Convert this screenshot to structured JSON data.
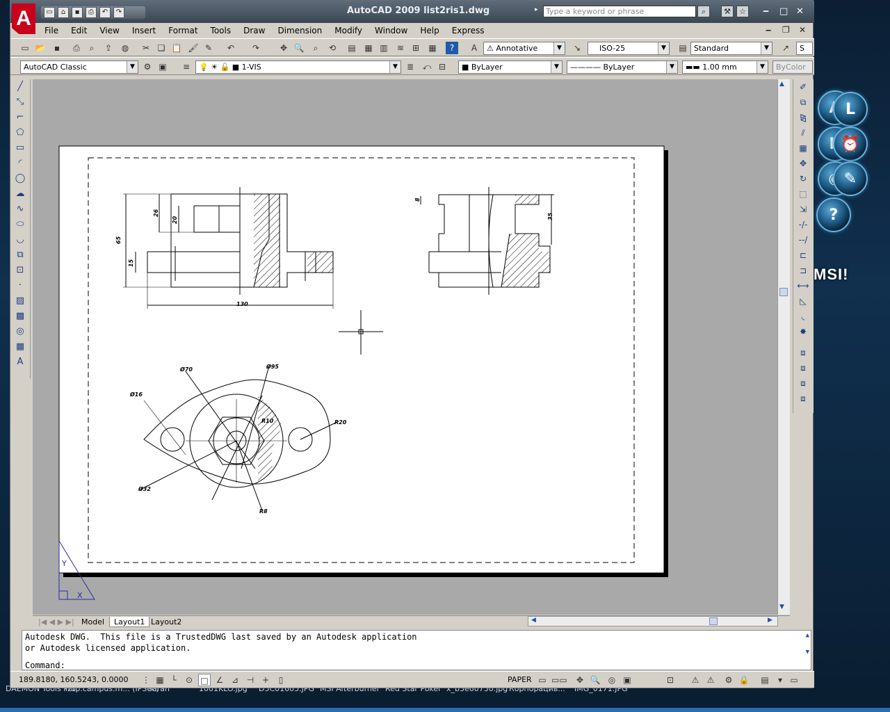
{
  "window": {
    "title": "AutoCAD 2009 list2ris1.dwg",
    "search_placeholder": "Type a keyword or phrase",
    "minimize": "‒",
    "maximize": "□",
    "close": "✕",
    "app_letter": "A"
  },
  "menubar": [
    "File",
    "Edit",
    "View",
    "Insert",
    "Format",
    "Tools",
    "Draw",
    "Dimension",
    "Modify",
    "Window",
    "Help",
    "Express"
  ],
  "styles_toolbar": {
    "text_style": "Annotative",
    "dim_style": "ISO-25",
    "table_style": "Standard",
    "multileader_style": "S"
  },
  "layers_toolbar": {
    "workspace": "AutoCAD Classic",
    "layer": "1-VIS",
    "color": "ByLayer",
    "linetype": "ByLayer",
    "lineweight": "1.00 mm",
    "plotstyle": "ByColor"
  },
  "drawing": {
    "dims_front": {
      "d26": "26",
      "d20": "20",
      "d65": "65",
      "d15": "15",
      "d130": "130"
    },
    "dims_side": {
      "d8": "8",
      "d35": "35"
    },
    "dims_top": {
      "d70": "Ø70",
      "d95": "Ø95",
      "d16": "Ø16",
      "r10": "R10",
      "r20": "R20",
      "d32": "Ø32",
      "r8": "R8"
    }
  },
  "ucs": {
    "x": "X",
    "y": "Y"
  },
  "layout_tabs": [
    "Model",
    "Layout1",
    "Layout2"
  ],
  "command": {
    "line1": "Autodesk DWG.  This file is a TrustedDWG last saved by an Autodesk application",
    "line2": "or Autodesk licensed application.",
    "prompt": "Command:"
  },
  "status": {
    "coords": "189.8180, 160.5243, 0.0000",
    "space": "PAPER"
  },
  "taskbar_items": [
    "DAEMON Tools Pro",
    "l2tp.campus.m... (IPSec)",
    "Saran",
    "1001KLO.jpg",
    "D5C01605.JPG",
    "MSI Afterburner",
    "Red Star Poker",
    "x_b3e60730.jpg",
    "Корпорацив...",
    "IMG_0171.JPG"
  ],
  "desktop_brand": "MSI!"
}
